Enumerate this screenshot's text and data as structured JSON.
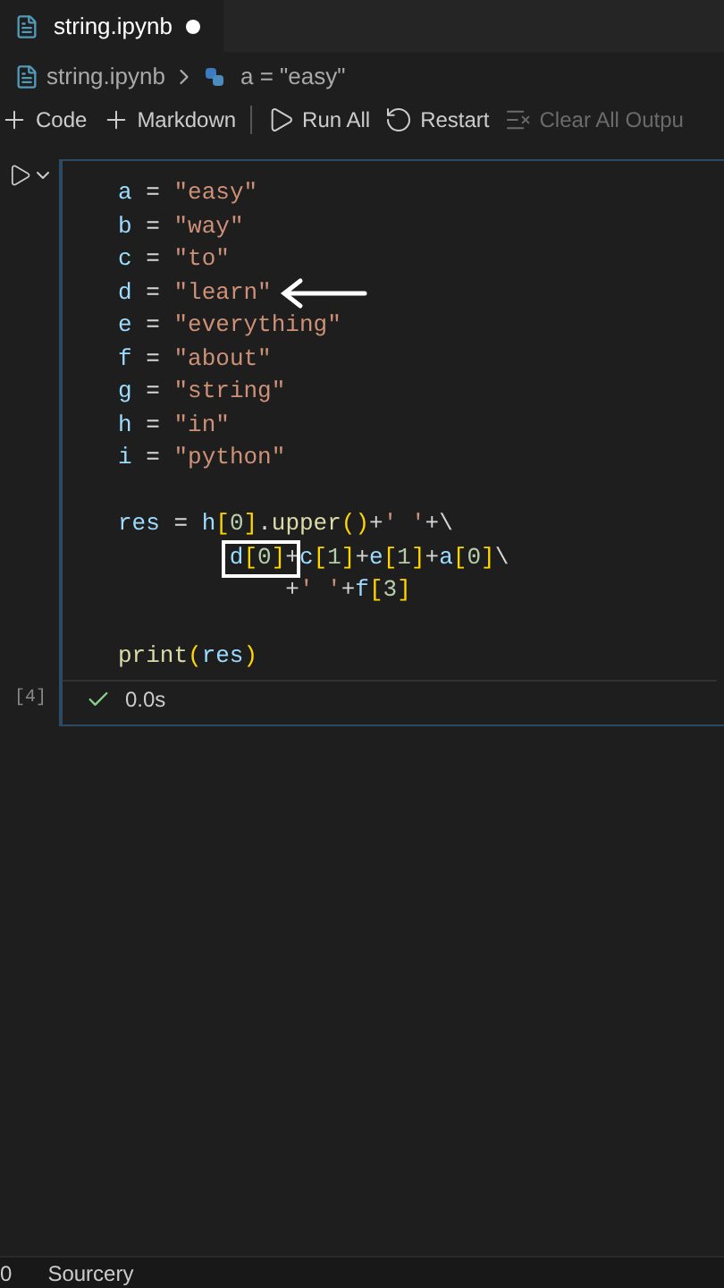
{
  "tab": {
    "title": "string.ipynb",
    "unsaved": true
  },
  "breadcrumb": {
    "file": "string.ipynb",
    "cell": "a = \"easy\""
  },
  "toolbar": [
    {
      "kind": "plus",
      "label": "Code",
      "disabled": false
    },
    {
      "kind": "plus",
      "label": "Markdown",
      "disabled": false
    },
    {
      "kind": "run",
      "label": "Run All",
      "disabled": false
    },
    {
      "kind": "restart",
      "label": "Restart",
      "disabled": false
    },
    {
      "kind": "clear",
      "label": "Clear All Outpu",
      "disabled": true
    }
  ],
  "cell": {
    "lines": [
      {
        "kind": "code",
        "text": "a = \"easy\""
      },
      {
        "kind": "code",
        "text": "b = \"way\""
      },
      {
        "kind": "code",
        "text": "c = \"to\""
      },
      {
        "kind": "code",
        "text": "d = \"learn\"",
        "arrow": true
      },
      {
        "kind": "code",
        "text": "e = \"everything\""
      },
      {
        "kind": "code",
        "text": "f = \"about\""
      },
      {
        "kind": "code",
        "text": "g = \"string\""
      },
      {
        "kind": "code",
        "text": "h = \"in\""
      },
      {
        "kind": "code",
        "text": "i = \"python\""
      },
      {
        "kind": "blank"
      },
      {
        "kind": "code",
        "text": "res = h[0].upper()+' '+\\"
      },
      {
        "kind": "code",
        "text": "        d[0]+c[1]+e[1]+a[0]\\",
        "boxed": true
      },
      {
        "kind": "code",
        "text": "            +' '+f[3]"
      },
      {
        "kind": "blank"
      },
      {
        "kind": "code",
        "text": "print(res)"
      }
    ],
    "execution_count": "[4]",
    "succeeded": true,
    "duration": "0.0s"
  },
  "status_bar": {
    "problems": "0",
    "extension": "Sourcery"
  }
}
